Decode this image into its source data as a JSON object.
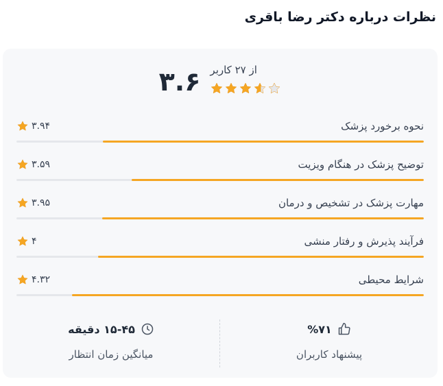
{
  "title": "نظرات درباره دکتر رضا باقری",
  "summary": {
    "score": "۳.۶",
    "count_text": "از ۲۷ کاربر",
    "rating_value": 3.6,
    "rating_max": 5
  },
  "colors": {
    "accent": "#f5a623",
    "star_empty": "#e5e7eb"
  },
  "criteria": [
    {
      "label": "نحوه برخورد پزشک",
      "value": "۳.۹۴",
      "score": 3.94
    },
    {
      "label": "توضیح پزشک در هنگام ویزیت",
      "value": "۳.۵۹",
      "score": 3.59
    },
    {
      "label": "مهارت پزشک در تشخیص و درمان",
      "value": "۳.۹۵",
      "score": 3.95
    },
    {
      "label": "فرآیند پذیرش و رفتار منشی",
      "value": "۴",
      "score": 4
    },
    {
      "label": "شرایط محیطی",
      "value": "۴.۳۲",
      "score": 4.32
    }
  ],
  "stats": {
    "recommend": {
      "value": "%۷۱",
      "label": "پیشنهاد کاربران",
      "icon": "thumbs-up-icon"
    },
    "wait_time": {
      "value": "۱۵-۴۵ دقیقه",
      "label": "میانگین زمان انتظار",
      "icon": "clock-icon"
    }
  }
}
